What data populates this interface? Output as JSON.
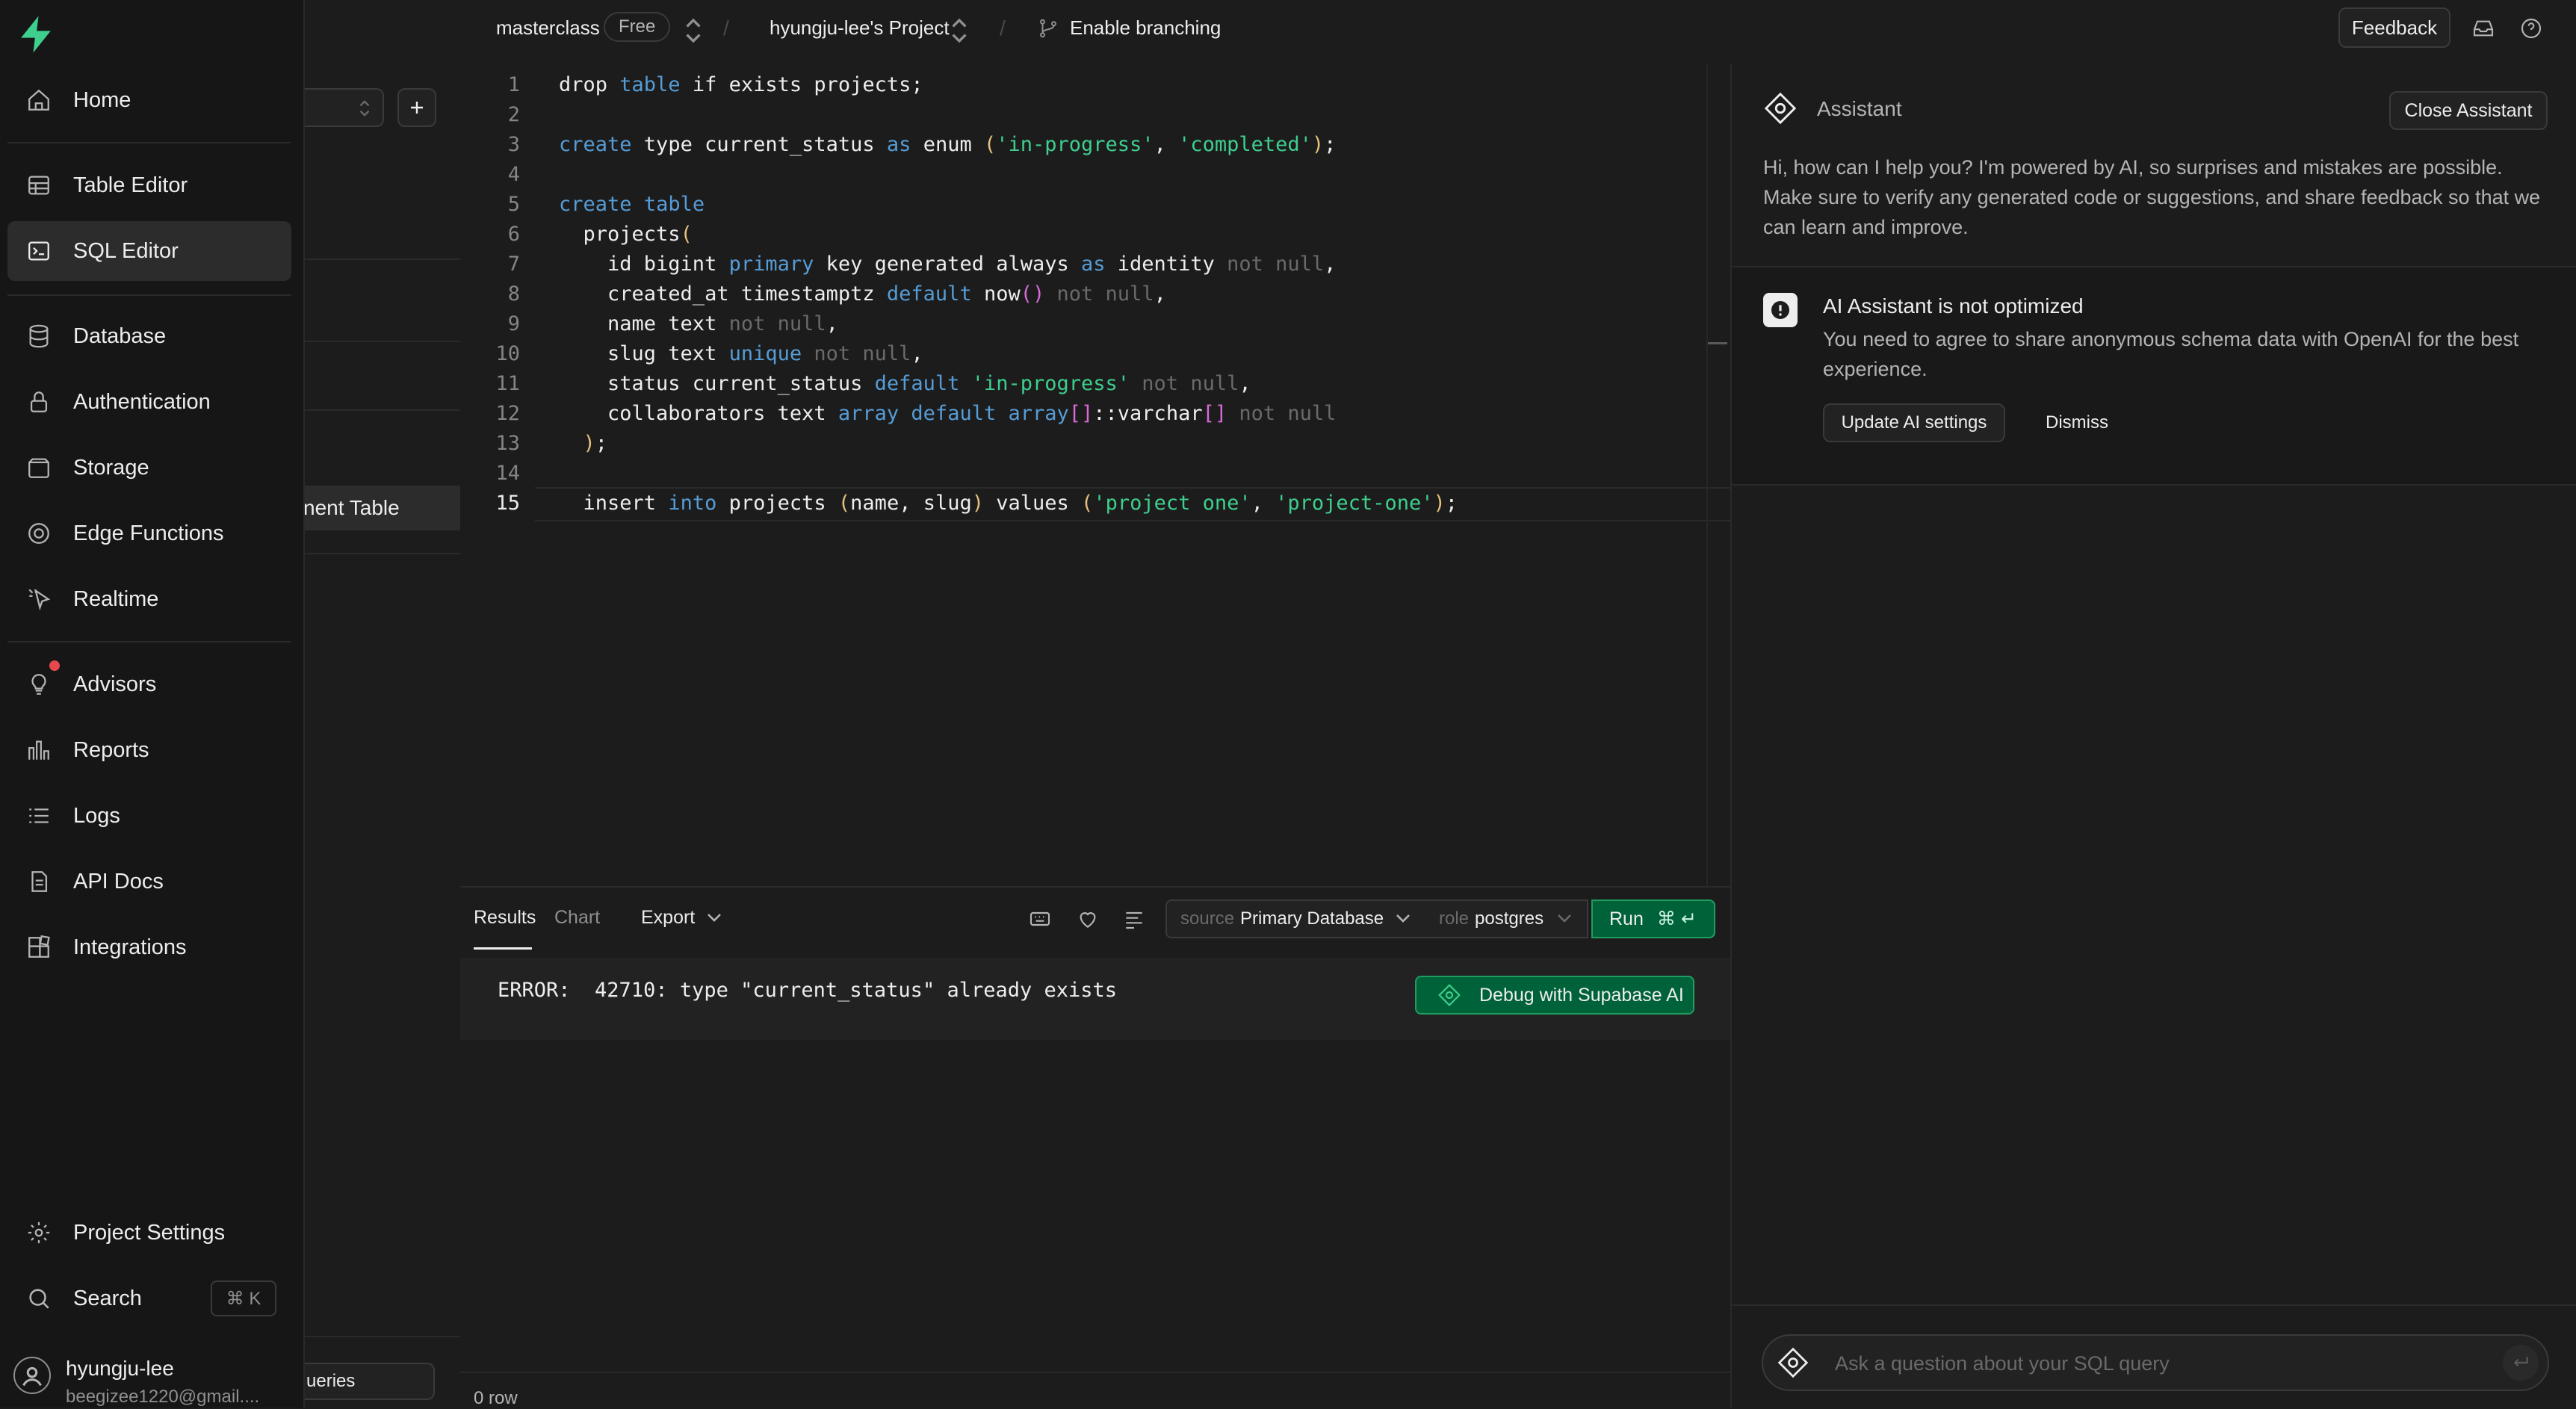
{
  "nav": {
    "items": [
      {
        "label": "Home",
        "icon": "home-icon"
      },
      {
        "label": "Table Editor",
        "icon": "table-icon"
      },
      {
        "label": "SQL Editor",
        "icon": "terminal-icon"
      },
      {
        "label": "Database",
        "icon": "database-icon"
      },
      {
        "label": "Authentication",
        "icon": "lock-icon"
      },
      {
        "label": "Storage",
        "icon": "storage-icon"
      },
      {
        "label": "Edge Functions",
        "icon": "functions-icon"
      },
      {
        "label": "Realtime",
        "icon": "realtime-icon"
      },
      {
        "label": "Advisors",
        "icon": "lightbulb-icon"
      },
      {
        "label": "Reports",
        "icon": "reports-icon"
      },
      {
        "label": "Logs",
        "icon": "logs-icon"
      },
      {
        "label": "API Docs",
        "icon": "document-icon"
      },
      {
        "label": "Integrations",
        "icon": "integrations-icon"
      },
      {
        "label": "Project Settings",
        "icon": "gear-icon"
      },
      {
        "label": "Search",
        "icon": "search-icon"
      }
    ],
    "search_shortcut": "⌘ K",
    "user": {
      "name": "hyungju-lee",
      "email": "beegizee1220@gmail...."
    }
  },
  "explorer": {
    "selected_item": "nent Table",
    "bottom_button": "ueries"
  },
  "topbar": {
    "org": "masterclass",
    "plan_badge": "Free",
    "project": "hyungju-lee's Project",
    "branching": "Enable branching",
    "feedback": "Feedback"
  },
  "editor": {
    "lines": [
      "1",
      "2",
      "3",
      "4",
      "5",
      "6",
      "7",
      "8",
      "9",
      "10",
      "11",
      "12",
      "13",
      "14",
      "15"
    ],
    "current_line": "15"
  },
  "results": {
    "tabs": [
      "Results",
      "Chart"
    ],
    "export_label": "Export",
    "source_prefix": "source",
    "source_value": "Primary Database",
    "role_prefix": "role",
    "role_value": "postgres",
    "run_label": "Run",
    "run_shortcut": "⌘ ↵",
    "error": "ERROR:  42710: type \"current_status\" already exists",
    "debug_label": "Debug with Supabase AI",
    "row_count": "0 row"
  },
  "assistant": {
    "title": "Assistant",
    "close_label": "Close Assistant",
    "intro": "Hi, how can I help you? I'm powered by AI, so surprises and mistakes are possible. Make sure to verify any generated code or suggestions, and share feedback so that we can learn and improve.",
    "notice_title": "AI Assistant is not optimized",
    "notice_body": "You need to agree to share anonymous schema data with OpenAI for the best experience.",
    "update_label": "Update AI settings",
    "dismiss_label": "Dismiss",
    "input_placeholder": "Ask a question about your SQL query"
  },
  "colors": {
    "brand": "#3ecf8e",
    "keyword": "#569cd6",
    "string": "#3ecf8e",
    "background": "#1c1c1c",
    "accent_button": "#006239"
  }
}
